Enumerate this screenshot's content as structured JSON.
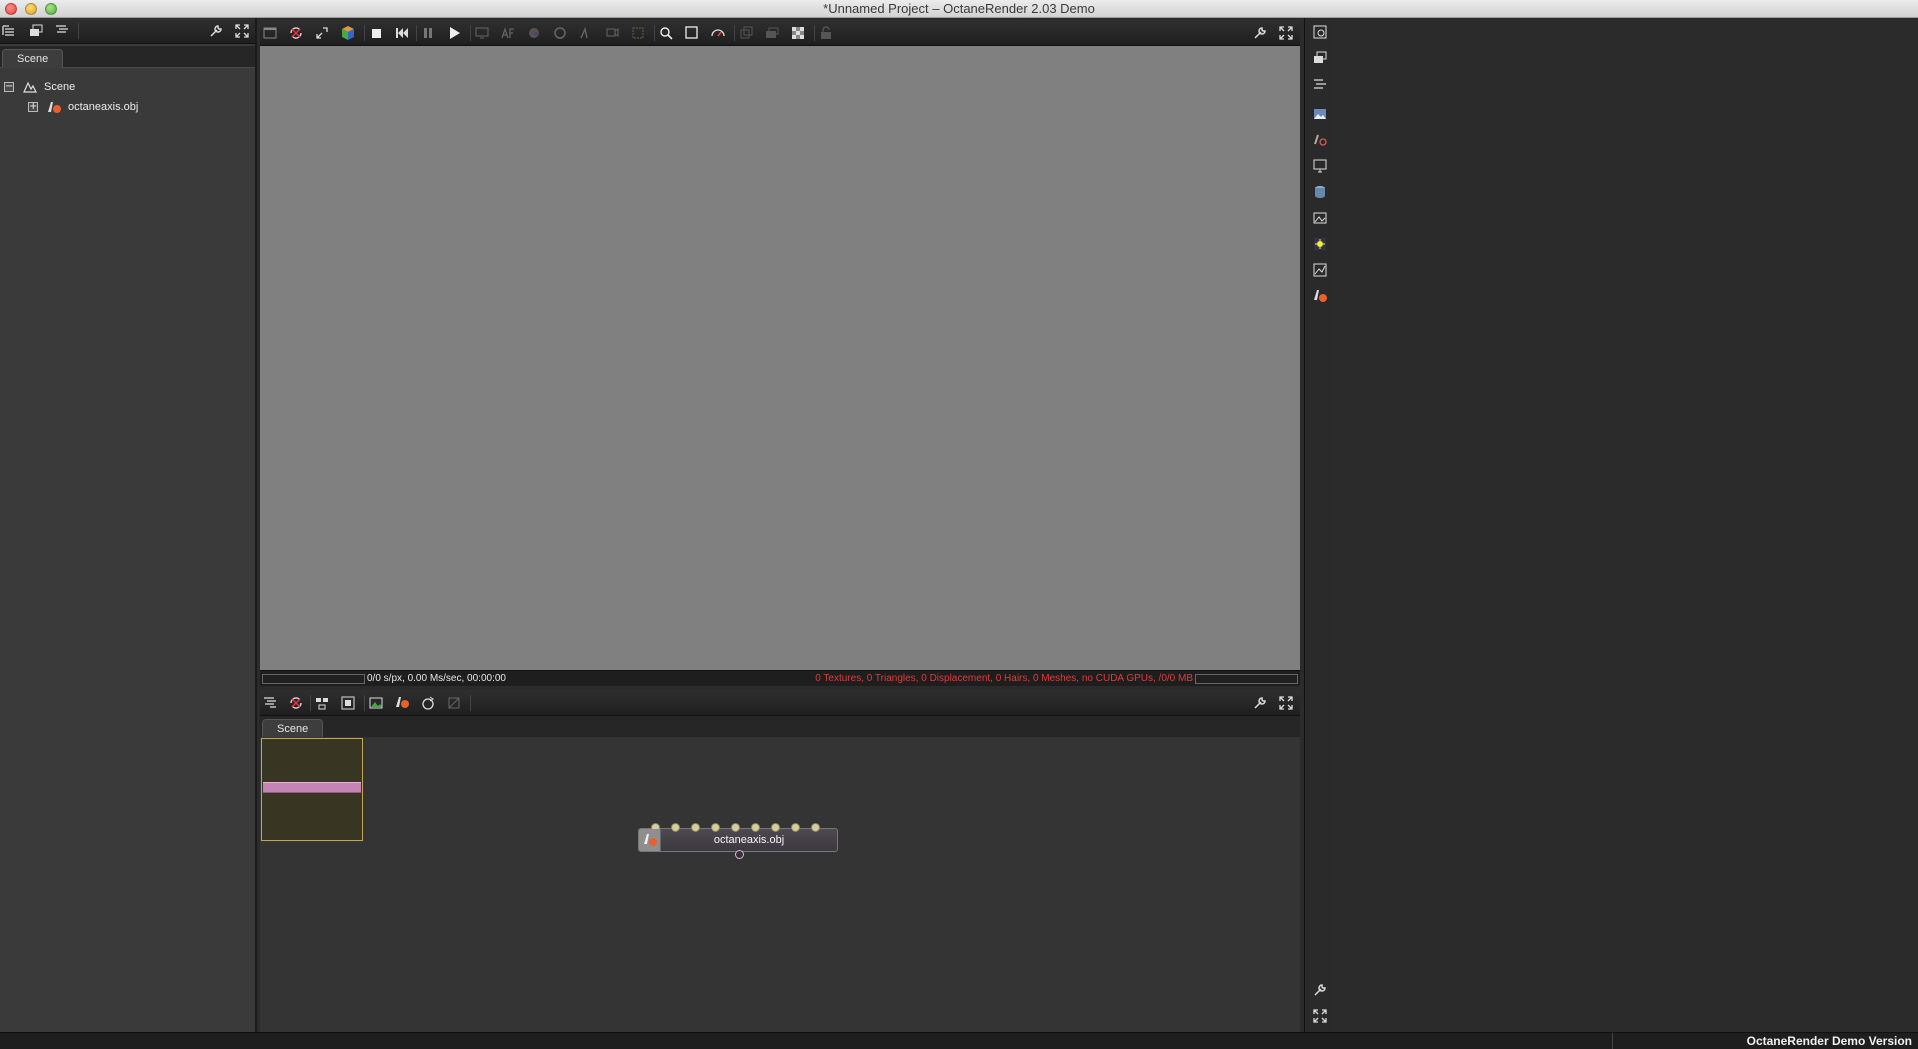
{
  "window": {
    "title": "*Unnamed Project – OctaneRender 2.03 Demo"
  },
  "scene_panel": {
    "tab_label": "Scene",
    "tree": [
      {
        "label": "Scene",
        "expander": "−"
      },
      {
        "label": "octaneaxis.obj",
        "expander": "+"
      }
    ]
  },
  "viewport": {
    "background": "#808080",
    "status_left": "0/0 s/px, 0.00 Ms/sec, 00:00:00",
    "status_right": "0 Textures, 0 Triangles, 0 Displacement, 0 Hairs, 0 Meshes, no CUDA GPUs, /0/0 MB",
    "status_right_color": "#e23a3a"
  },
  "graph_editor": {
    "tab_label": "Scene",
    "node": {
      "label": "octaneaxis.obj",
      "input_pins": 9,
      "output_pins": 1
    }
  },
  "statusbar": {
    "text": "OctaneRender Demo Version"
  },
  "icons": {
    "left_toolbar": [
      "outliner-icon",
      "layers-icon",
      "hierarchy-icon",
      "wrench-icon",
      "maximize-icon"
    ],
    "render_toolbar": [
      "render-window-icon",
      "reload-icon",
      "zoom-fit-icon",
      "color-cube-icon",
      "stop-icon",
      "restart-icon",
      "pause-icon",
      "play-icon",
      "viewport-icon",
      "af-icon",
      "color-picker-icon",
      "material-picker-icon",
      "object-picker-icon",
      "camera-picker-icon",
      "region-icon",
      "zoom-lens-icon",
      "frame-icon",
      "gauge-icon",
      "copy-icon",
      "save-icon",
      "checker-icon",
      "lock-icon",
      "wrench-icon",
      "maximize-icon"
    ],
    "graph_toolbar": [
      "hierarchy-icon",
      "reload-icon",
      "arrange-icon",
      "arrange-all-icon",
      "add-image-icon",
      "mesh-icon",
      "refresh-material-icon",
      "clear-icon",
      "wrench-icon",
      "maximize-icon"
    ],
    "right_strip": [
      "render-settings-icon",
      "layers-icon",
      "hierarchy-icon",
      "image-icon",
      "material-icon",
      "monitor-icon",
      "database-icon",
      "picture-icon",
      "light-icon",
      "graph-icon",
      "mesh-icon",
      "wrench-icon",
      "maximize-icon"
    ]
  }
}
